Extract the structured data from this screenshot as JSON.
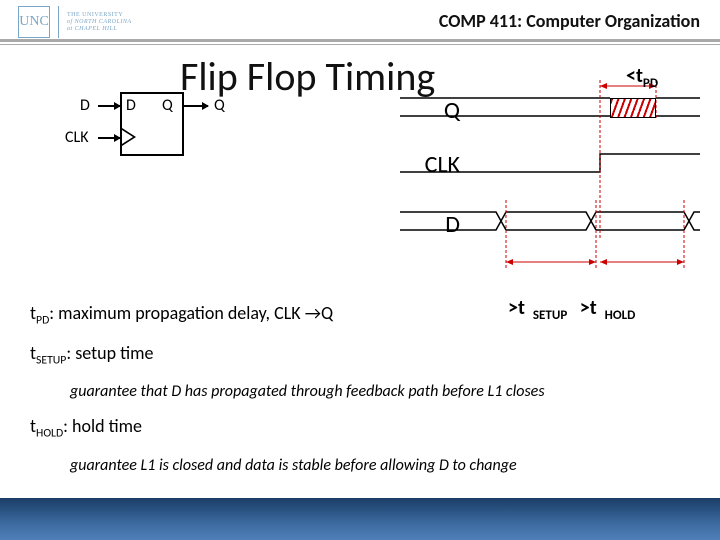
{
  "header": {
    "logo_text": "UNC",
    "univ_line1": "THE UNIVERSITY",
    "univ_line2": "of NORTH CAROLINA",
    "univ_line3": "at CHAPEL HILL",
    "course": "COMP 411: Computer Organization"
  },
  "title": "Flip Flop Timing",
  "block": {
    "d_in": "D",
    "clk": "CLK",
    "d_port": "D",
    "q_port": "Q",
    "q_out": "Q"
  },
  "timing": {
    "q": "Q",
    "clk": "CLK",
    "d": "D",
    "tpd_label": "<t",
    "tpd_sub": "PD",
    "gt_setup": ">t",
    "gt_setup_sub": "SETUP",
    "gt_hold": ">t",
    "gt_hold_sub": "HOLD"
  },
  "defs": {
    "line1a": "t",
    "line1a_sub": "PD",
    "line1b": ": maximum propagation delay, CLK →Q",
    "line2a": "t",
    "line2a_sub": "SETUP",
    "line2b": ": setup time",
    "line2_indent": "guarantee that D has propagated through feedback path before L1 closes",
    "line3a": "t",
    "line3a_sub": "HOLD",
    "line3b": ": hold time",
    "line3_indent": "guarantee L1 is closed and data is stable before allowing D to change"
  }
}
